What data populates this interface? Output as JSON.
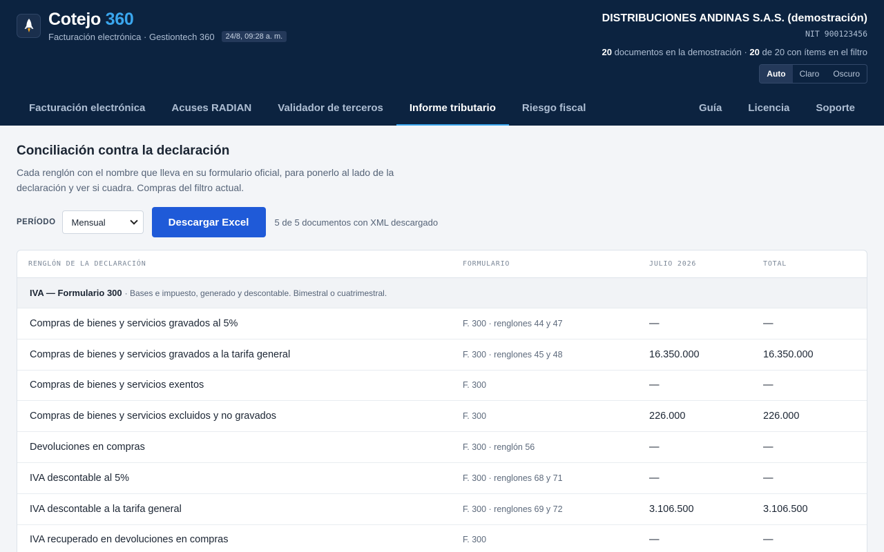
{
  "header": {
    "brand_main": "Cotejo",
    "brand_accent": "360",
    "subtitle": "Facturación electrónica · Gestiontech 360",
    "date": "24/8, 09:28 a. m.",
    "company": "DISTRIBUCIONES ANDINAS S.A.S. (demostración)",
    "nit": "NIT 900123456",
    "doc_count_a": "20",
    "doc_count_text_a": "documentos en la demostración ·",
    "doc_count_b": "20",
    "doc_count_text_b": "de 20 con ítems en el filtro",
    "theme": [
      "Auto",
      "Claro",
      "Oscuro"
    ],
    "logo_icon": "rocket-icon"
  },
  "nav": {
    "tabs": [
      "Facturación electrónica",
      "Acuses RADIAN",
      "Validador de terceros",
      "Informe tributario",
      "Riesgo fiscal"
    ],
    "right": [
      "Guía",
      "Licencia",
      "Soporte"
    ],
    "active": "Informe tributario"
  },
  "main": {
    "title": "Conciliación contra la declaración",
    "description": "Cada renglón con el nombre que lleva en su formulario oficial, para ponerlo al lado de la declaración y ver si cuadra. Compras del filtro actual.",
    "periodo_label": "PERÍODO",
    "periodo_value": "Mensual",
    "download_button": "Descargar Excel",
    "xml_status": "5 de 5 documentos con XML descargado"
  },
  "table": {
    "headers": [
      "RENGLÓN DE LA DECLARACIÓN",
      "FORMULARIO",
      "JULIO 2026",
      "TOTAL"
    ],
    "section_title": "IVA — Formulario 300",
    "section_desc": "· Bases e impuesto, generado y descontable. Bimestral o cuatrimestral.",
    "rows": [
      {
        "renglon": "Compras de bienes y servicios gravados al 5%",
        "formulario": "F. 300 · renglones 44 y 47",
        "mes": "—",
        "total": "—"
      },
      {
        "renglon": "Compras de bienes y servicios gravados a la tarifa general",
        "formulario": "F. 300 · renglones 45 y 48",
        "mes": "16.350.000",
        "total": "16.350.000"
      },
      {
        "renglon": "Compras de bienes y servicios exentos",
        "formulario": "F. 300",
        "mes": "—",
        "total": "—"
      },
      {
        "renglon": "Compras de bienes y servicios excluidos y no gravados",
        "formulario": "F. 300",
        "mes": "226.000",
        "total": "226.000"
      },
      {
        "renglon": "Devoluciones en compras",
        "formulario": "F. 300 · renglón 56",
        "mes": "—",
        "total": "—"
      },
      {
        "renglon": "IVA descontable al 5%",
        "formulario": "F. 300 · renglones 68 y 71",
        "mes": "—",
        "total": "—"
      },
      {
        "renglon": "IVA descontable a la tarifa general",
        "formulario": "F. 300 · renglones 69 y 72",
        "mes": "3.106.500",
        "total": "3.106.500"
      },
      {
        "renglon": "IVA recuperado en devoluciones en compras",
        "formulario": "F. 300",
        "mes": "—",
        "total": "—"
      }
    ]
  }
}
